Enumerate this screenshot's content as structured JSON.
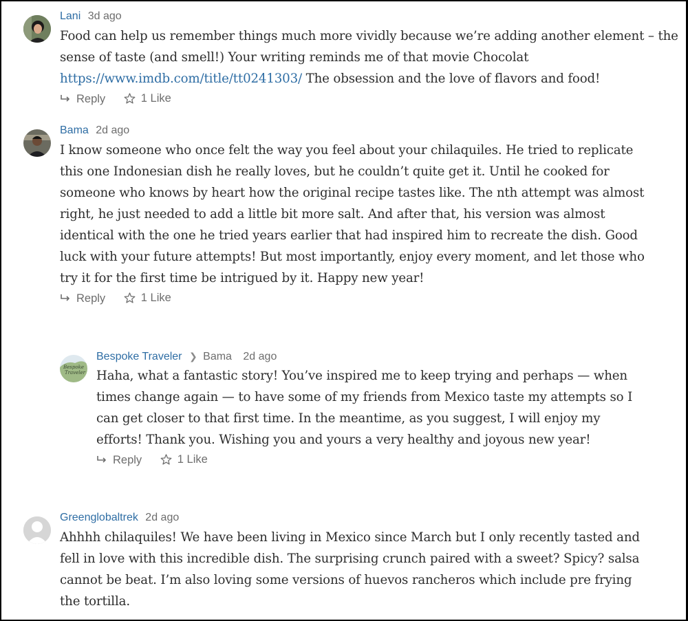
{
  "colors": {
    "author_link": "#2e6da4",
    "meta_gray": "#6d6d6d",
    "body_text": "#2e2e2e"
  },
  "comments": [
    {
      "author": "Lani",
      "time": "3d ago",
      "avatar": "photo-avatar",
      "text_parts": [
        "Food can help us remember things much more vividly because we’re adding another element – the sense of taste (and smell!) Your writing reminds me of that movie Chocolat ",
        "https://www.imdb.com/title/tt0241303/",
        " The obsession and the love of flavors and food!"
      ],
      "reply_label": "Reply",
      "like_label": "1 Like"
    },
    {
      "author": "Bama",
      "time": "2d ago",
      "avatar": "photo-avatar",
      "text": "I know someone who once felt the way you feel about your chilaquiles. He tried to replicate this one Indonesian dish he really loves, but he couldn’t quite get it. Until he cooked for someone who knows by heart how the original recipe tastes like. The nth attempt was almost right, he just needed to add a little bit more salt. And after that, his version was almost identical with the one he tried years earlier that had inspired him to recreate the dish. Good luck with your future attempts! But most importantly, enjoy every moment, and let those who try it for the first time be intrigued by it. Happy new year!",
      "reply_label": "Reply",
      "like_label": "1 Like"
    },
    {
      "author": "Bespoke Traveler",
      "reply_to": "Bama",
      "time": "2d ago",
      "avatar": "logo-avatar",
      "text": "Haha, what a fantastic story! You’ve inspired me to keep trying and perhaps — when times change again — to have some of my friends from Mexico taste my attempts so I can get closer to that first time. In the meantime, as you suggest, I will enjoy my efforts! Thank you. Wishing you and yours a very healthy and joyous new year!",
      "reply_label": "Reply",
      "like_label": "1 Like"
    },
    {
      "author": "Greenglobaltrek",
      "time": "2d ago",
      "avatar": "default-avatar",
      "text": "Ahhhh chilaquiles! We have been living in Mexico since March but I only recently tasted and fell in love with this incredible dish. The surprising crunch paired with a sweet? Spicy? salsa cannot be beat. I’m also loving some versions of huevos rancheros which include pre frying the tortilla."
    }
  ]
}
